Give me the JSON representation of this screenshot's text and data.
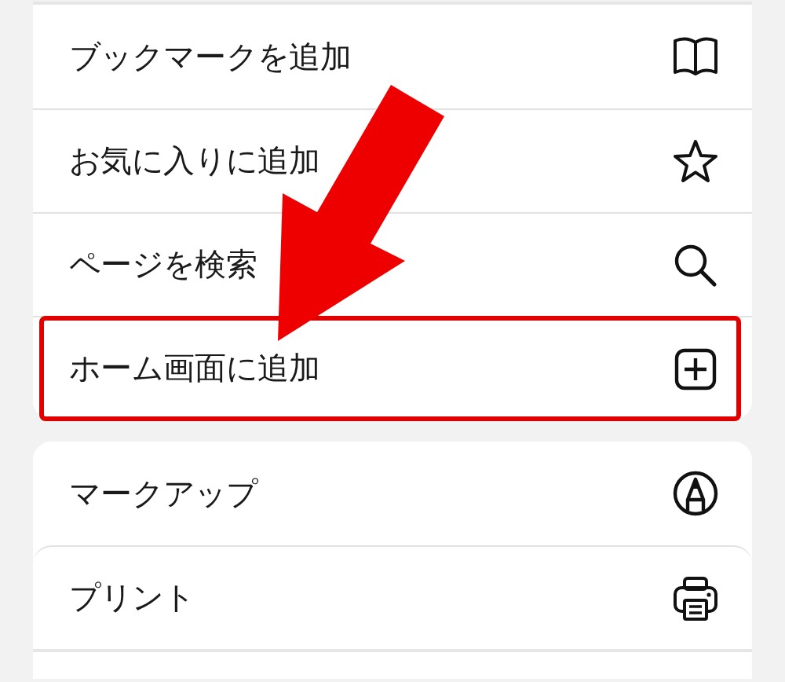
{
  "groups": [
    {
      "items": [
        {
          "label": "ブックマークを追加",
          "kind": "bookmark",
          "highlighted": false
        },
        {
          "label": "お気に入りに追加",
          "kind": "favorite",
          "highlighted": false
        },
        {
          "label": "ページを検索",
          "kind": "find",
          "highlighted": false
        },
        {
          "label": "ホーム画面に追加",
          "kind": "home_screen",
          "highlighted": true
        }
      ]
    },
    {
      "items": [
        {
          "label": "マークアップ",
          "kind": "markup",
          "highlighted": false
        },
        {
          "label": "プリント",
          "kind": "print",
          "highlighted": false
        }
      ]
    }
  ]
}
